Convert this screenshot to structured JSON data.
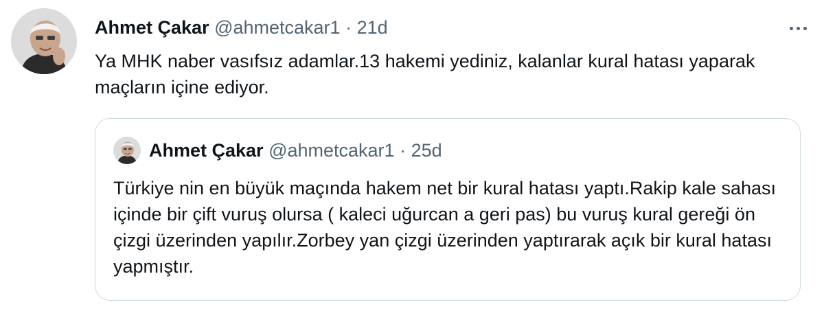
{
  "tweet": {
    "author_name": "Ahmet Çakar",
    "handle": "@ahmetcakar1",
    "separator": "·",
    "time": "21d",
    "text": "Ya MHK naber vasıfsız adamlar.13 hakemi yediniz, kalanlar kural hatası yaparak maçların içine ediyor.",
    "more_icon": "more-dots-icon",
    "avatar_icon": "avatar"
  },
  "quoted_tweet": {
    "author_name": "Ahmet Çakar",
    "handle": "@ahmetcakar1",
    "separator": "·",
    "time": "25d",
    "text": "Türkiye nin en büyük maçında hakem net bir kural hatası yaptı.Rakip kale sahası içinde bir çift vuruş olursa ( kaleci uğurcan a geri pas) bu vuruş kural gereği ön çizgi üzerinden yapılır.Zorbey yan çizgi üzerinden yaptırarak açık bir kural hatası yapmıştır."
  },
  "colors": {
    "text_primary": "#0f1419",
    "text_secondary": "#536471",
    "border": "#cfd9de"
  }
}
